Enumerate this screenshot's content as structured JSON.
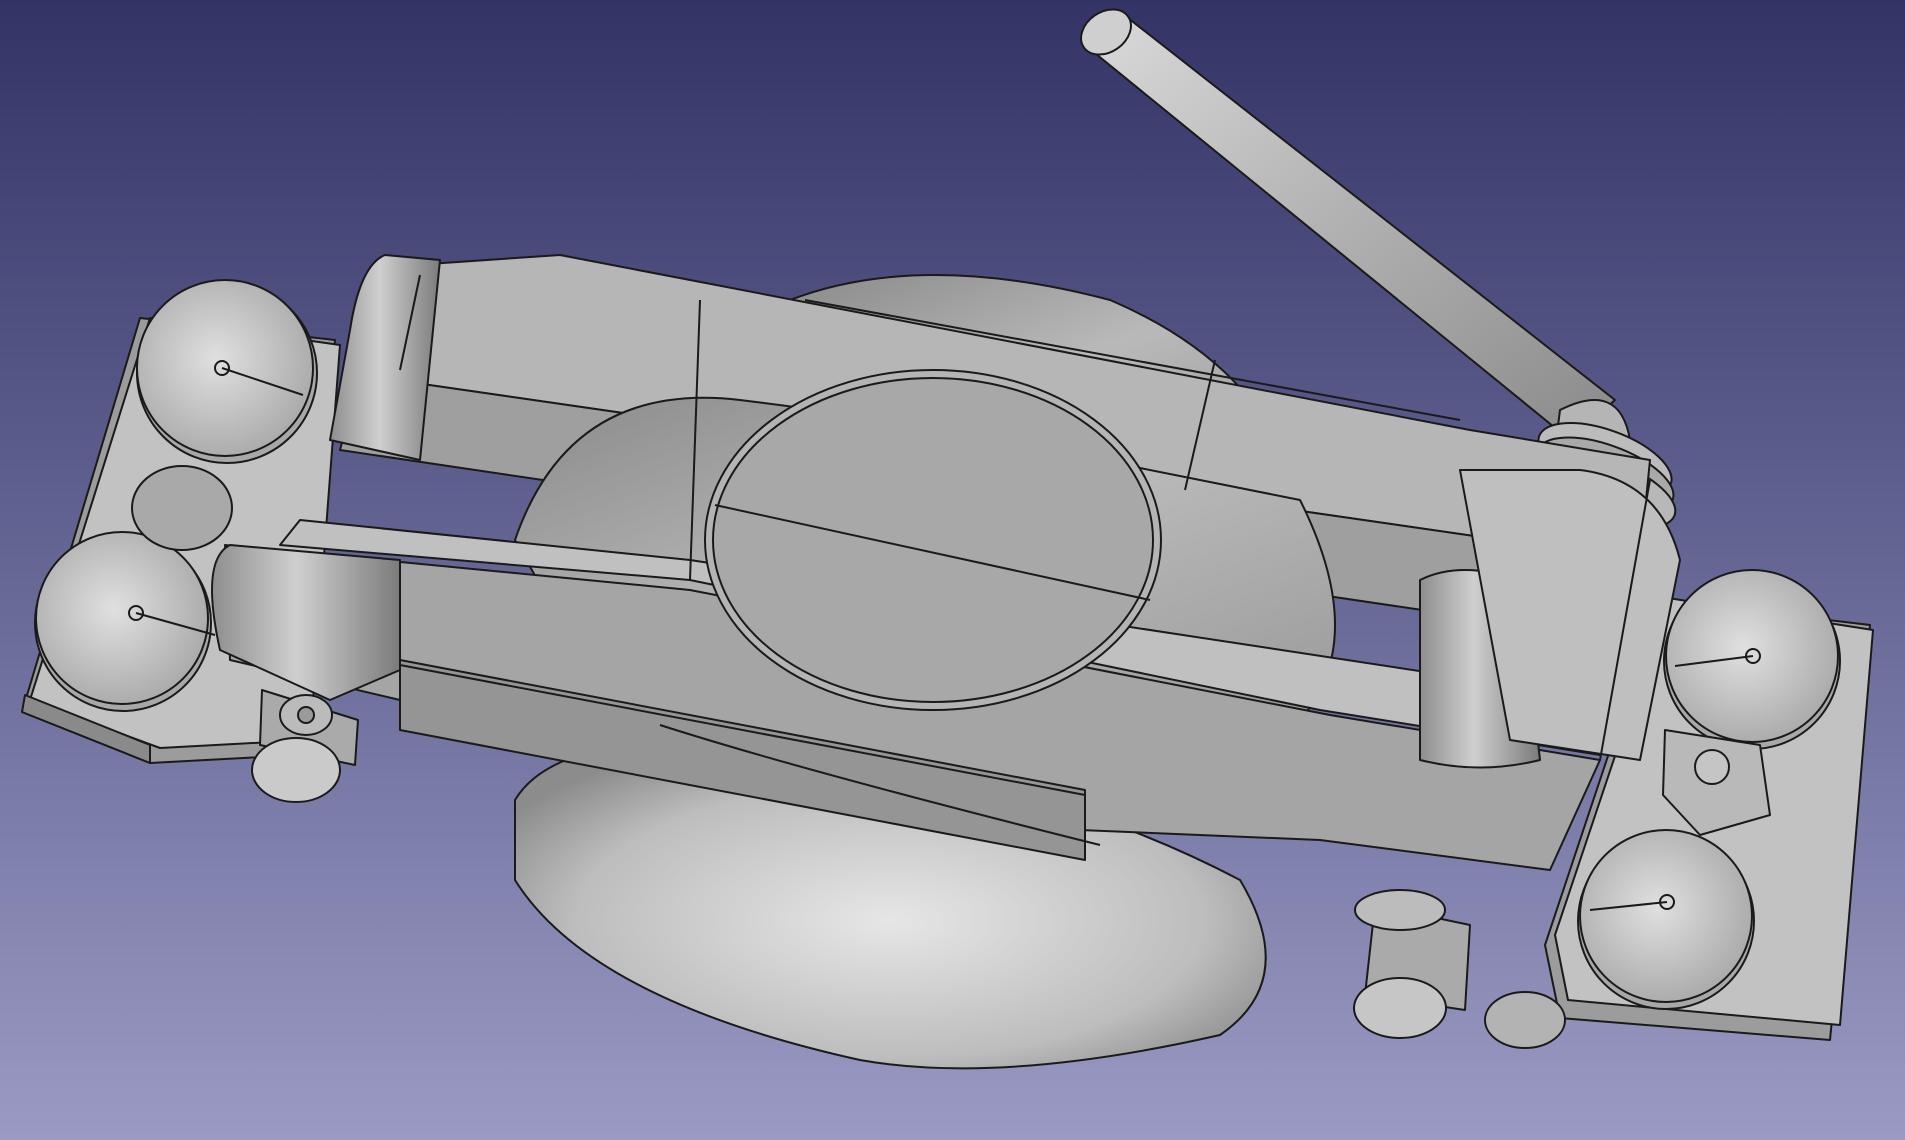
{
  "app": {
    "view": "3d-viewport",
    "background": {
      "top": "#333366",
      "bottom": "#9a9ac4"
    },
    "model_color": "#c4c4c4",
    "edge_color": "#1a1a1a"
  },
  "model": {
    "icons": [
      "lever-handle-icon",
      "clamp-body-icon",
      "cup-icon"
    ]
  }
}
